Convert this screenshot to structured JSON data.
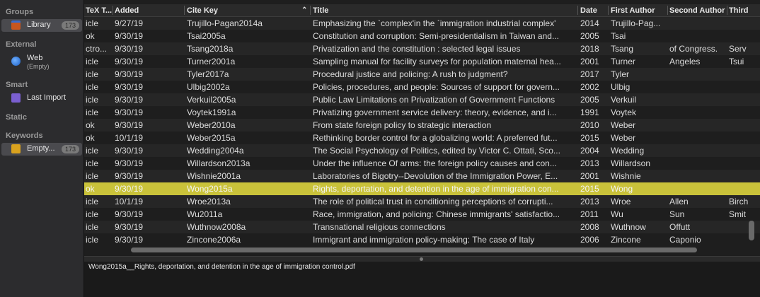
{
  "sidebar": {
    "groups_heading": "Groups",
    "library_label": "Library",
    "library_count": "173",
    "external_heading": "External",
    "web_label": "Web",
    "web_sublabel": "(Empty)",
    "smart_heading": "Smart",
    "last_import_label": "Last Import",
    "static_heading": "Static",
    "keywords_heading": "Keywords",
    "keyword_label": "Empty...",
    "keyword_count": "173"
  },
  "columns": [
    "TeX T...",
    "Added",
    "Cite Key",
    "Title",
    "Date",
    "First Author",
    "Second Author",
    "Third"
  ],
  "sort_indicator": "⌃",
  "rows": [
    {
      "type": "icle",
      "added": "9/27/19",
      "key": "Trujillo-Pagan2014a",
      "title": "Emphasizing the `complex'in the `immigration industrial complex'",
      "date": "2014",
      "first": "Trujillo-Pag...",
      "second": "",
      "third": ""
    },
    {
      "type": "ok",
      "added": "9/30/19",
      "key": "Tsai2005a",
      "title": "Constitution and corruption: Semi-presidentialism in Taiwan and...",
      "date": "2005",
      "first": "Tsai",
      "second": "",
      "third": ""
    },
    {
      "type": "ctro...",
      "added": "9/30/19",
      "key": "Tsang2018a",
      "title": "Privatization and the constitution : selected legal issues",
      "date": "2018",
      "first": "Tsang",
      "second": "of Congress.",
      "third": "Serv"
    },
    {
      "type": "icle",
      "added": "9/30/19",
      "key": "Turner2001a",
      "title": "Sampling manual for facility surveys for population maternal hea...",
      "date": "2001",
      "first": "Turner",
      "second": "Angeles",
      "third": "Tsui"
    },
    {
      "type": "icle",
      "added": "9/30/19",
      "key": "Tyler2017a",
      "title": "Procedural justice and policing: A rush to judgment?",
      "date": "2017",
      "first": "Tyler",
      "second": "",
      "third": ""
    },
    {
      "type": "icle",
      "added": "9/30/19",
      "key": "Ulbig2002a",
      "title": "Policies, procedures, and people: Sources of support for govern...",
      "date": "2002",
      "first": "Ulbig",
      "second": "",
      "third": ""
    },
    {
      "type": "icle",
      "added": "9/30/19",
      "key": "Verkuil2005a",
      "title": "Public Law Limitations on Privatization of Government Functions",
      "date": "2005",
      "first": "Verkuil",
      "second": "",
      "third": ""
    },
    {
      "type": "icle",
      "added": "9/30/19",
      "key": "Voytek1991a",
      "title": "Privatizing government service delivery: theory, evidence, and i...",
      "date": "1991",
      "first": "Voytek",
      "second": "",
      "third": ""
    },
    {
      "type": "ok",
      "added": "9/30/19",
      "key": "Weber2010a",
      "title": "From state foreign policy to strategic interaction",
      "date": "2010",
      "first": "Weber",
      "second": "",
      "third": ""
    },
    {
      "type": "ok",
      "added": "10/1/19",
      "key": "Weber2015a",
      "title": "Rethinking border control for a globalizing world: A preferred fut...",
      "date": "2015",
      "first": "Weber",
      "second": "",
      "third": ""
    },
    {
      "type": "icle",
      "added": "9/30/19",
      "key": "Wedding2004a",
      "title": "The Social Psychology of Politics, edited by Victor C. Ottati, Sco...",
      "date": "2004",
      "first": "Wedding",
      "second": "",
      "third": ""
    },
    {
      "type": "icle",
      "added": "9/30/19",
      "key": "Willardson2013a",
      "title": "Under the influence Of arms: the foreign policy causes and con...",
      "date": "2013",
      "first": "Willardson",
      "second": "",
      "third": ""
    },
    {
      "type": "icle",
      "added": "9/30/19",
      "key": "Wishnie2001a",
      "title": "Laboratories of Bigotry--Devolution of the Immigration Power, E...",
      "date": "2001",
      "first": "Wishnie",
      "second": "",
      "third": ""
    },
    {
      "type": "ok",
      "added": "9/30/19",
      "key": "Wong2015a",
      "title": "Rights, deportation, and detention in the age of immigration con...",
      "date": "2015",
      "first": "Wong",
      "second": "",
      "third": ""
    },
    {
      "type": "icle",
      "added": "10/1/19",
      "key": "Wroe2013a",
      "title": "The role of political trust in conditioning perceptions of corrupti...",
      "date": "2013",
      "first": "Wroe",
      "second": "Allen",
      "third": "Birch"
    },
    {
      "type": "icle",
      "added": "9/30/19",
      "key": "Wu2011a",
      "title": "Race, immigration, and policing: Chinese immigrants' satisfactio...",
      "date": "2011",
      "first": "Wu",
      "second": "Sun",
      "third": "Smit"
    },
    {
      "type": "icle",
      "added": "9/30/19",
      "key": "Wuthnow2008a",
      "title": "Transnational religious connections",
      "date": "2008",
      "first": "Wuthnow",
      "second": "Offutt",
      "third": ""
    },
    {
      "type": "icle",
      "added": "9/30/19",
      "key": "Zincone2006a",
      "title": "Immigrant and immigration policy-making: The case of Italy",
      "date": "2006",
      "first": "Zincone",
      "second": "Caponio",
      "third": ""
    }
  ],
  "selected_index": 13,
  "file_pane": {
    "filename": "Wong2015a__Rights, deportation, and detention in the age of immigration control.pdf"
  },
  "colors": {
    "selection": "#c9c23a",
    "sidebar_bg": "#2c2c2e",
    "table_bg": "#1e1e1e"
  }
}
